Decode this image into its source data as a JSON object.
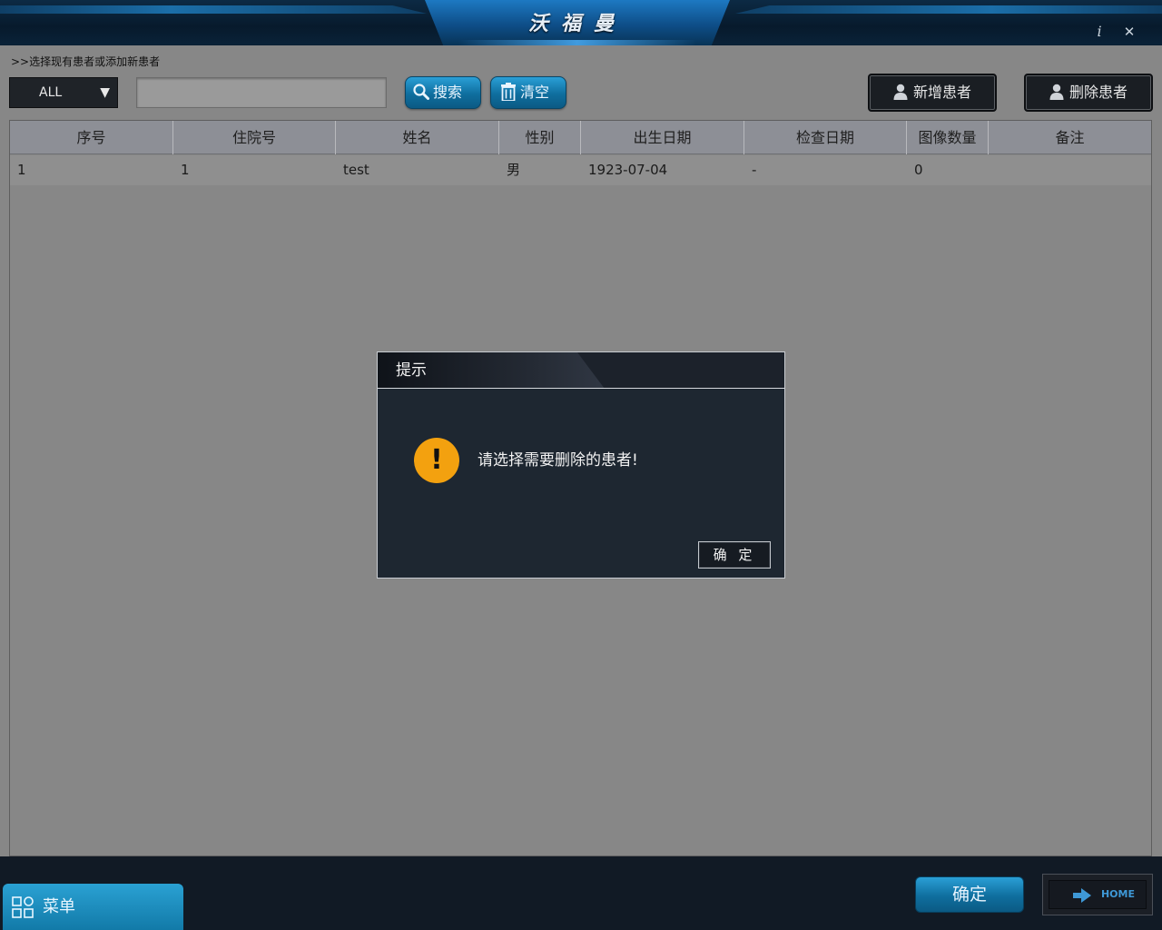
{
  "app": {
    "title": "沃福曼",
    "info_label": "i",
    "close_label": "✕"
  },
  "breadcrumb": ">>选择现有患者或添加新患者",
  "toolbar": {
    "filter_value": "ALL",
    "search_placeholder": "",
    "search_label": "搜索",
    "clear_label": "清空",
    "add_patient_label": "新增患者",
    "delete_patient_label": "删除患者"
  },
  "table": {
    "columns": [
      "序号",
      "住院号",
      "姓名",
      "性别",
      "出生日期",
      "检查日期",
      "图像数量",
      "备注"
    ],
    "rows": [
      [
        "1",
        "1",
        "test",
        "男",
        "1923-07-04",
        "-",
        "0",
        ""
      ]
    ]
  },
  "dialog": {
    "title": "提示",
    "icon": "exclamation-icon",
    "icon_glyph": "!",
    "message": "请选择需要删除的患者!",
    "ok_label": "确 定"
  },
  "bottom": {
    "menu_label": "菜单",
    "confirm_label": "确定",
    "home_label": "HOME"
  },
  "colors": {
    "accent_blue": "#1f8fc6",
    "warning": "#f3a10f",
    "dialog_bg": "#1e2731"
  }
}
